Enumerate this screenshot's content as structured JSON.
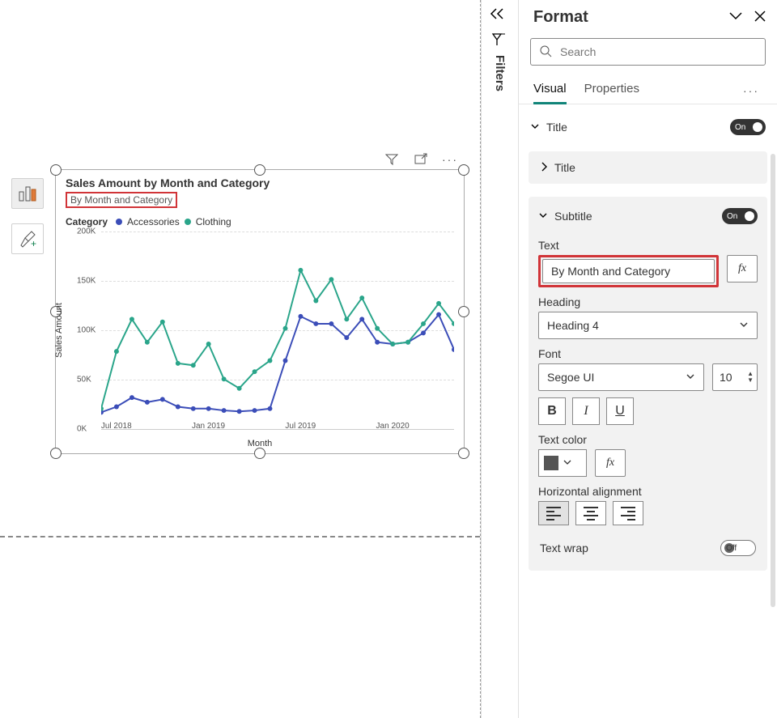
{
  "filters": {
    "label": "Filters"
  },
  "format_pane": {
    "header": "Format",
    "search_placeholder": "Search",
    "tabs": {
      "visual": "Visual",
      "properties": "Properties"
    },
    "title_section": {
      "label": "Title",
      "toggle": "On",
      "inner": "Title"
    },
    "subtitle_section": {
      "label": "Subtitle",
      "toggle": "On",
      "text_label": "Text",
      "text_value": "By Month and Category",
      "heading_label": "Heading",
      "heading_value": "Heading 4",
      "font_label": "Font",
      "font_value": "Segoe UI",
      "font_size": "10",
      "text_color_label": "Text color",
      "halign_label": "Horizontal alignment",
      "text_wrap_label": "Text wrap",
      "text_wrap_toggle": "Off",
      "fx": "fx"
    }
  },
  "chart": {
    "title": "Sales Amount by Month and Category",
    "subtitle": "By Month and Category",
    "legend_title": "Category",
    "legend": [
      "Accessories",
      "Clothing"
    ],
    "y_title": "Sales Amount",
    "x_title": "Month",
    "y_ticks": [
      "0K",
      "50K",
      "100K",
      "150K",
      "200K"
    ],
    "x_ticks": [
      "Jul 2018",
      "Jan 2019",
      "Jul 2019",
      "Jan 2020"
    ]
  },
  "chart_data": {
    "type": "line",
    "title": "Sales Amount by Month and Category",
    "xlabel": "Month",
    "ylabel": "Sales Amount",
    "ylim": [
      0,
      200000
    ],
    "x_tick_labels": [
      "Jul 2018",
      "Jan 2019",
      "Jul 2019",
      "Jan 2020"
    ],
    "categories": [
      "2018-06",
      "2018-07",
      "2018-08",
      "2018-09",
      "2018-10",
      "2018-11",
      "2018-12",
      "2019-01",
      "2019-02",
      "2019-03",
      "2019-04",
      "2019-05",
      "2019-06",
      "2019-07",
      "2019-08",
      "2019-09",
      "2019-10",
      "2019-11",
      "2019-12",
      "2020-01",
      "2020-02",
      "2020-03",
      "2020-04",
      "2020-05"
    ],
    "series": [
      {
        "name": "Accessories",
        "color": "#3b4db8",
        "values": [
          4000,
          10000,
          20000,
          15000,
          18000,
          10000,
          8000,
          8000,
          6000,
          5000,
          6000,
          8000,
          60000,
          108000,
          100000,
          100000,
          85000,
          105000,
          80000,
          78000,
          80000,
          90000,
          110000,
          72000
        ]
      },
      {
        "name": "Clothing",
        "color": "#2aa58a",
        "values": [
          8000,
          70000,
          105000,
          80000,
          102000,
          57000,
          55000,
          78000,
          40000,
          30000,
          48000,
          60000,
          95000,
          158000,
          125000,
          148000,
          105000,
          128000,
          95000,
          78000,
          80000,
          100000,
          122000,
          100000
        ]
      }
    ]
  }
}
